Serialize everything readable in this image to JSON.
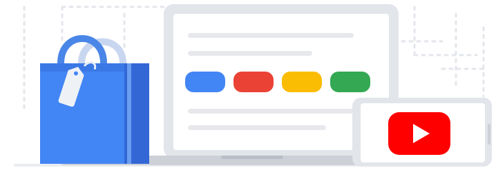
{
  "illustration": {
    "icons": [
      "shopping-bag-icon",
      "price-tag-icon",
      "laptop-icon",
      "phone-icon",
      "youtube-play-icon"
    ],
    "colors": {
      "bag_front": "#4285F4",
      "bag_side": "#3367D6",
      "bag_handle": "#4A86E8",
      "tag": "#EEF2F7",
      "laptop_frame": "#E2E5EA",
      "laptop_screen": "#FFFFFF",
      "text_line": "#E6E8EC",
      "blue": "#4285F4",
      "red": "#EA4335",
      "yellow": "#FBBC04",
      "green": "#34A853",
      "youtube_red": "#FF0000",
      "dots": "#E3E6EB",
      "base": "#CDD1D7"
    },
    "color_pills": [
      "blue",
      "red",
      "yellow",
      "green"
    ]
  }
}
